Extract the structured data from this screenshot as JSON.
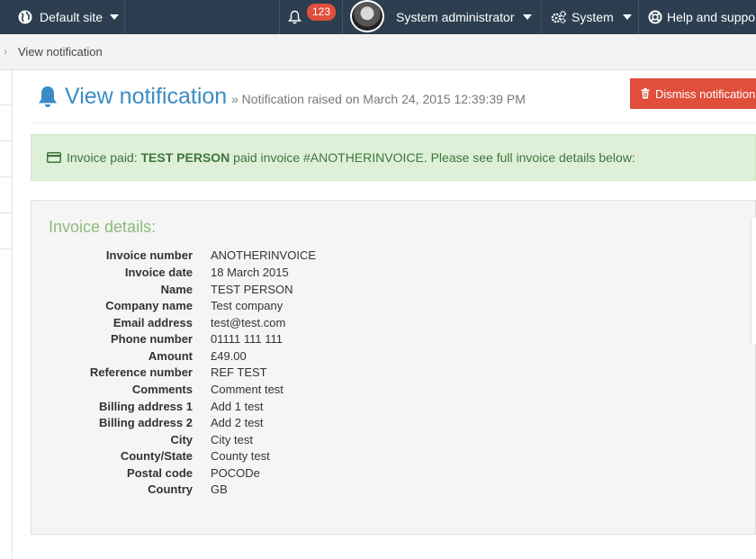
{
  "topbar": {
    "site_label": "Default site",
    "notification_count": "123",
    "user_label": "System administrator",
    "system_label": "System",
    "help_label": "Help and support"
  },
  "breadcrumb": {
    "current": "View notification"
  },
  "header": {
    "title": "View notification",
    "subtitle": "» Notification raised on March 24, 2015 12:39:39 PM",
    "dismiss_label": "Dismiss notification"
  },
  "alert": {
    "prefix": "Invoice paid: ",
    "person": "TEST PERSON",
    "suffix": " paid invoice #ANOTHERINVOICE. Please see full invoice details below:"
  },
  "details": {
    "title": "Invoice details:",
    "rows": [
      {
        "label": "Invoice number",
        "value": "ANOTHERINVOICE"
      },
      {
        "label": "Invoice date",
        "value": "18 March 2015"
      },
      {
        "label": "Name",
        "value": "TEST PERSON"
      },
      {
        "label": "Company name",
        "value": "Test company"
      },
      {
        "label": "Email address",
        "value": "test@test.com"
      },
      {
        "label": "Phone number",
        "value": "01111 111 111"
      },
      {
        "label": "Amount",
        "value": "£49.00"
      },
      {
        "label": "Reference number",
        "value": "REF TEST"
      },
      {
        "label": "Comments",
        "value": "Comment test"
      },
      {
        "label": "Billing address 1",
        "value": "Add 1 test"
      },
      {
        "label": "Billing address 2",
        "value": "Add 2 test"
      },
      {
        "label": "City",
        "value": "City test"
      },
      {
        "label": "County/State",
        "value": "County test"
      },
      {
        "label": "Postal code",
        "value": "POCODe"
      },
      {
        "label": "Country",
        "value": "GB"
      }
    ]
  },
  "colors": {
    "topbar": "#2c3e50",
    "title": "#3b8cc4",
    "danger": "#e04f3c",
    "success_bg": "#dff0d8",
    "success_text": "#3c763d"
  },
  "icons": [
    "globe-icon",
    "bell-icon",
    "cogs-icon",
    "lifebuoy-icon",
    "trash-icon",
    "credit-card-icon"
  ]
}
